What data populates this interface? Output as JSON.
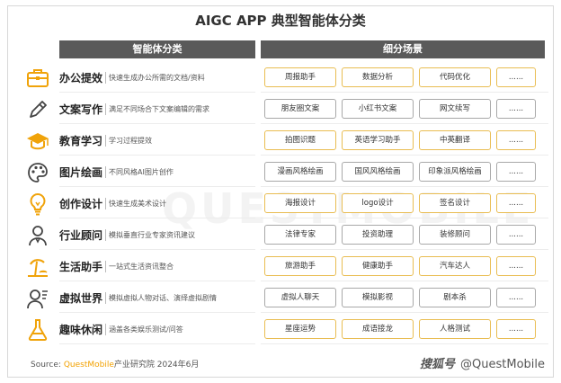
{
  "title": "AIGC APP 典型智能体分类",
  "header": {
    "left": "智能体分类",
    "right": "细分场景"
  },
  "rows": [
    {
      "icon": "briefcase-icon",
      "name": "办公提效",
      "desc": "快速生成办公所需的文档/资料",
      "chips": [
        "周报助手",
        "数据分析",
        "代码优化",
        "......"
      ]
    },
    {
      "icon": "pen-icon",
      "name": "文案写作",
      "desc": "满足不同场合下文案编辑的需求",
      "chips": [
        "朋友圈文案",
        "小红书文案",
        "网文续写",
        "......"
      ]
    },
    {
      "icon": "graduation-cap-icon",
      "name": "教育学习",
      "desc": "学习过程提效",
      "chips": [
        "拍图识题",
        "英语学习助手",
        "中英翻译",
        "......"
      ]
    },
    {
      "icon": "palette-icon",
      "name": "图片绘画",
      "desc": "不同风格AI图片创作",
      "chips": [
        "漫画风格绘画",
        "国风风格绘画",
        "印象派风格绘画",
        "......"
      ]
    },
    {
      "icon": "lightbulb-icon",
      "name": "创作设计",
      "desc": "快速生成美术设计",
      "chips": [
        "海报设计",
        "logo设计",
        "签名设计",
        "......"
      ]
    },
    {
      "icon": "consultant-icon",
      "name": "行业顾问",
      "desc": "模拟垂直行业专家资讯建议",
      "chips": [
        "法律专家",
        "投资助理",
        "装修顾问",
        "......"
      ]
    },
    {
      "icon": "beach-icon",
      "name": "生活助手",
      "desc": "一站式生活资讯整合",
      "chips": [
        "旅游助手",
        "健康助手",
        "汽车达人",
        "......"
      ]
    },
    {
      "icon": "persona-icon",
      "name": "虚拟世界",
      "desc": "模拟虚拟人物对话、演绎虚拟剧情",
      "chips": [
        "虚拟人聊天",
        "模拟影视",
        "剧本杀",
        "......"
      ]
    },
    {
      "icon": "flask-icon",
      "name": "趣味休闲",
      "desc": "涵盖各类娱乐测试/问答",
      "chips": [
        "星座运势",
        "成语接龙",
        "人格测试",
        "......"
      ]
    }
  ],
  "source": {
    "prefix": "Source: ",
    "brand": "QuestMobile",
    "suffix": "产业研究院 2024年6月"
  },
  "watermark": {
    "logo": "搜狐号",
    "handle": "@QuestMobile"
  },
  "bg_watermark": "QUESTMOBILE",
  "colors": {
    "gold": "#e9bd52",
    "gray": "#a8a8a8",
    "header_bg": "#5a5a5a",
    "brand": "#f2a100"
  }
}
